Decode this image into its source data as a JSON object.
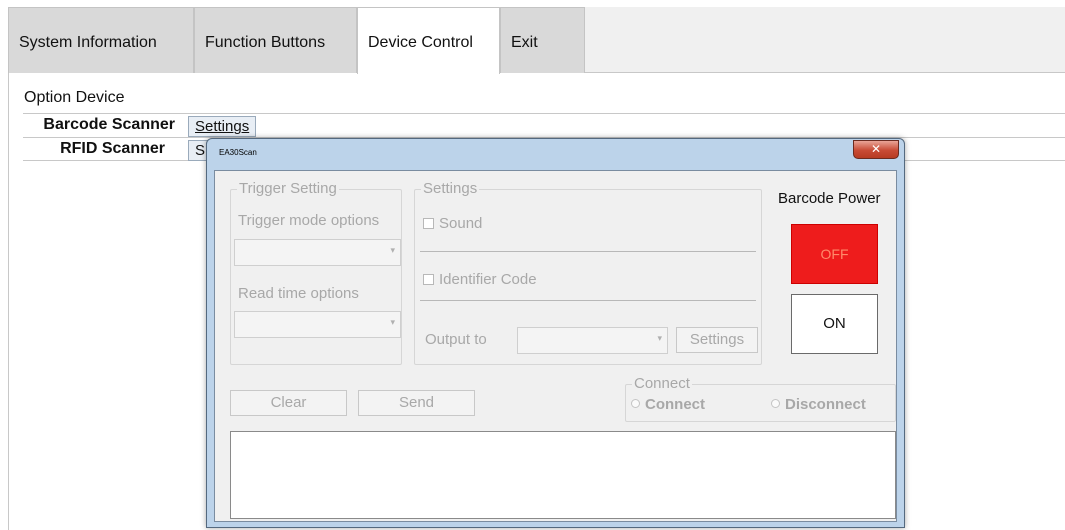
{
  "tabs": [
    {
      "label": "System Information"
    },
    {
      "label": "Function Buttons"
    },
    {
      "label": "Device Control",
      "active": true
    },
    {
      "label": "Exit"
    }
  ],
  "option_device": {
    "label": "Option Device",
    "rows": [
      {
        "name": "Barcode Scanner",
        "button": "Settings"
      },
      {
        "name": "RFID Scanner",
        "button": "S"
      }
    ]
  },
  "dialog": {
    "title": "EA30Scan",
    "close_icon": "close-icon",
    "trigger": {
      "group_title": "Trigger Setting",
      "mode_label": "Trigger mode options",
      "mode_value": "",
      "read_time_label": "Read time options",
      "read_time_value": ""
    },
    "settings": {
      "group_title": "Settings",
      "sound_label": "Sound",
      "identifier_label": "Identifier Code",
      "output_label": "Output to",
      "output_value": "",
      "settings_button": "Settings"
    },
    "barcode_power": {
      "label": "Barcode Power",
      "off_label": "OFF",
      "on_label": "ON",
      "off_color": "#ee1c1c"
    },
    "clear_button": "Clear",
    "send_button": "Send",
    "connect": {
      "group_title": "Connect",
      "connect_label": "Connect",
      "disconnect_label": "Disconnect"
    },
    "output_text": ""
  }
}
